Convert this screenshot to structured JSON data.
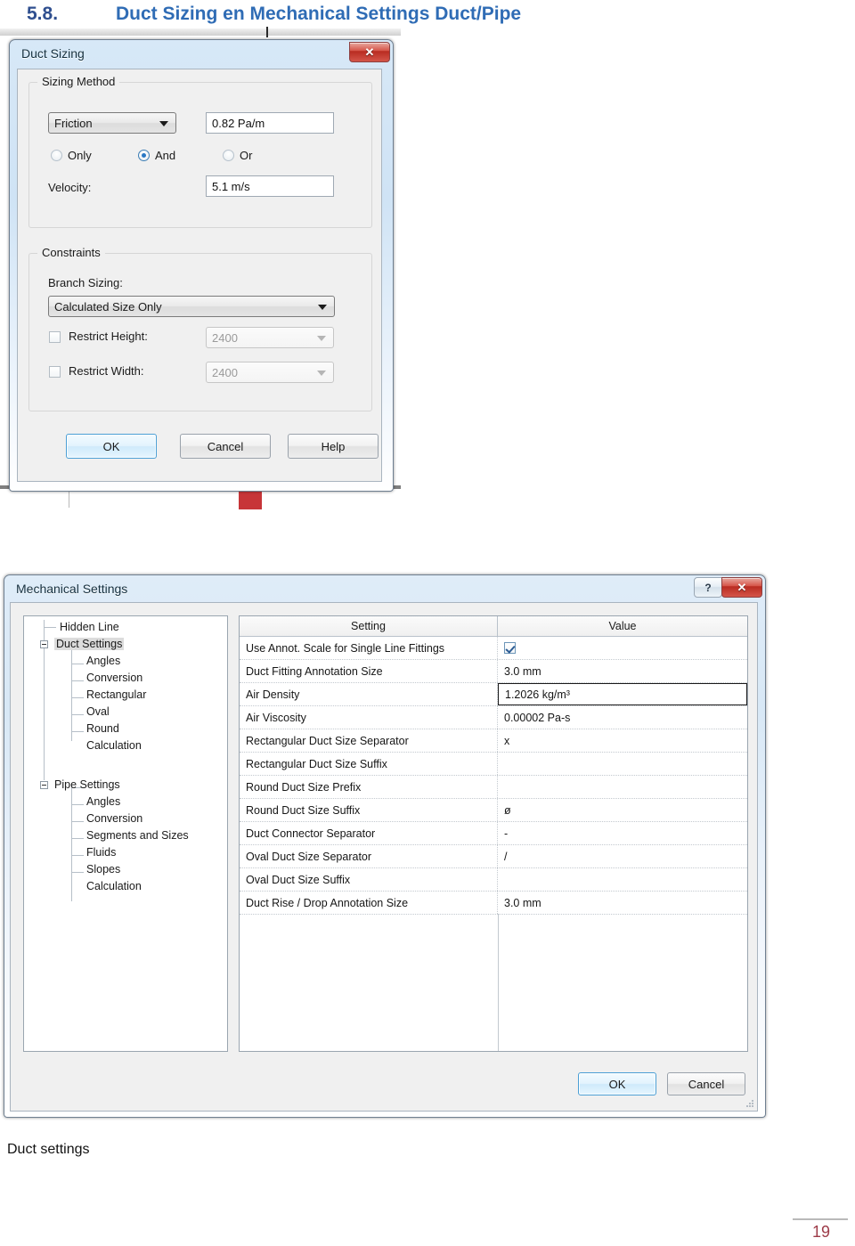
{
  "heading": {
    "number": "5.8.",
    "title": "Duct Sizing en Mechanical Settings Duct/Pipe"
  },
  "duct_sizing_dialog": {
    "title": "Duct Sizing",
    "close_label": "✕",
    "close_icon": "close-icon",
    "sizing_method": {
      "legend": "Sizing Method",
      "method_combo_value": "Friction",
      "friction_value": "0.82 Pa/m",
      "radios": [
        {
          "label": "Only",
          "selected": false
        },
        {
          "label": "And",
          "selected": true
        },
        {
          "label": "Or",
          "selected": false
        }
      ],
      "velocity_label": "Velocity:",
      "velocity_value": "5.1 m/s"
    },
    "constraints": {
      "legend": "Constraints",
      "branch_sizing_label": "Branch Sizing:",
      "branch_sizing_value": "Calculated Size Only",
      "restrict_height_label": "Restrict Height:",
      "restrict_height_value": "2400",
      "restrict_height_checked": false,
      "restrict_width_label": "Restrict Width:",
      "restrict_width_value": "2400",
      "restrict_width_checked": false
    },
    "buttons": {
      "ok": "OK",
      "cancel": "Cancel",
      "help": "Help"
    }
  },
  "mechanical_settings_dialog": {
    "title": "Mechanical Settings",
    "help_label": "?",
    "close_label": "✕",
    "tree": [
      {
        "label": "Hidden Line",
        "level": 1,
        "expandable": false,
        "selected": false
      },
      {
        "label": "Duct Settings",
        "level": 0,
        "expandable": true,
        "selected": true
      },
      {
        "label": "Angles",
        "level": 2,
        "expandable": false,
        "selected": false
      },
      {
        "label": "Conversion",
        "level": 2,
        "expandable": false,
        "selected": false
      },
      {
        "label": "Rectangular",
        "level": 2,
        "expandable": false,
        "selected": false
      },
      {
        "label": "Oval",
        "level": 2,
        "expandable": false,
        "selected": false
      },
      {
        "label": "Round",
        "level": 2,
        "expandable": false,
        "selected": false
      },
      {
        "label": "Calculation",
        "level": 2,
        "expandable": false,
        "selected": false
      },
      {
        "label": "Pipe Settings",
        "level": 0,
        "expandable": true,
        "selected": false
      },
      {
        "label": "Angles",
        "level": 2,
        "expandable": false,
        "selected": false
      },
      {
        "label": "Conversion",
        "level": 2,
        "expandable": false,
        "selected": false
      },
      {
        "label": "Segments and Sizes",
        "level": 2,
        "expandable": false,
        "selected": false
      },
      {
        "label": "Fluids",
        "level": 2,
        "expandable": false,
        "selected": false
      },
      {
        "label": "Slopes",
        "level": 2,
        "expandable": false,
        "selected": false
      },
      {
        "label": "Calculation",
        "level": 2,
        "expandable": false,
        "selected": false
      }
    ],
    "grid": {
      "headers": [
        "Setting",
        "Value"
      ],
      "rows": [
        {
          "setting": "Use Annot. Scale for Single Line Fittings",
          "value": "",
          "type": "checkbox",
          "checked": true,
          "active": false
        },
        {
          "setting": "Duct Fitting Annotation Size",
          "value": "3.0 mm",
          "type": "text",
          "active": false
        },
        {
          "setting": "Air Density",
          "value": "1.2026 kg/m³",
          "type": "text",
          "active": true
        },
        {
          "setting": "Air Viscosity",
          "value": "0.00002 Pa-s",
          "type": "text",
          "active": false
        },
        {
          "setting": "Rectangular Duct Size Separator",
          "value": "x",
          "type": "text",
          "active": false
        },
        {
          "setting": "Rectangular Duct Size Suffix",
          "value": "",
          "type": "text",
          "active": false
        },
        {
          "setting": "Round Duct Size Prefix",
          "value": "",
          "type": "text",
          "active": false
        },
        {
          "setting": "Round Duct Size Suffix",
          "value": "ø",
          "type": "text",
          "active": false
        },
        {
          "setting": "Duct Connector Separator",
          "value": "-",
          "type": "text",
          "active": false
        },
        {
          "setting": "Oval Duct Size Separator",
          "value": "/",
          "type": "text",
          "active": false
        },
        {
          "setting": "Oval Duct Size Suffix",
          "value": "",
          "type": "text",
          "active": false
        },
        {
          "setting": "Duct Rise / Drop Annotation Size",
          "value": "3.0 mm",
          "type": "text",
          "active": false
        }
      ]
    },
    "buttons": {
      "ok": "OK",
      "cancel": "Cancel"
    }
  },
  "figure_caption": "Duct settings",
  "page_number": "19",
  "colors": {
    "heading_blue": "#2f6cb5",
    "page_number": "#9d3b48",
    "close_red": "#b92c21",
    "accent_blue": "#4b9fd5"
  }
}
